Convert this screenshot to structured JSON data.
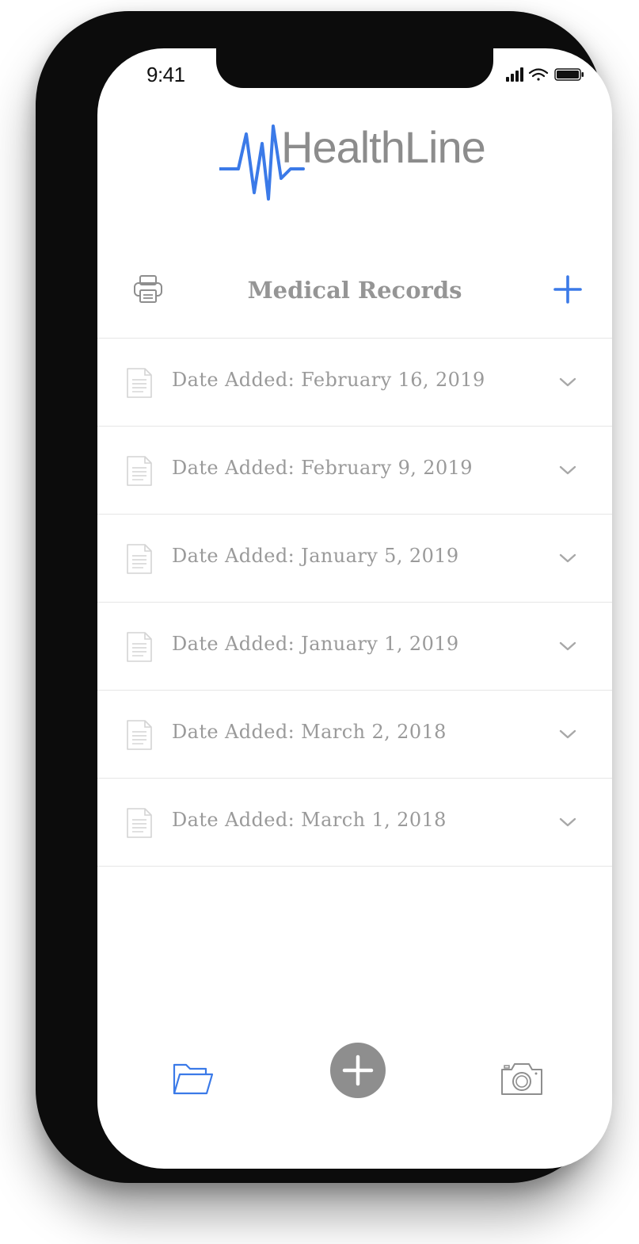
{
  "status_bar": {
    "time": "9:41"
  },
  "app": {
    "logo_text": "HealthLine",
    "accent_color": "#3b7ae8",
    "text_color": "#959595"
  },
  "header": {
    "title": "Medical Records",
    "left_icon": "printer-icon",
    "right_icon": "plus-icon"
  },
  "records": [
    {
      "label": "Date Added: February 16, 2019"
    },
    {
      "label": "Date Added: February 9, 2019"
    },
    {
      "label": "Date Added: January 5, 2019"
    },
    {
      "label": "Date Added: January 1, 2019"
    },
    {
      "label": "Date Added: March 2, 2018"
    },
    {
      "label": "Date Added: March 1, 2018"
    }
  ],
  "tab_bar": {
    "items": [
      {
        "icon": "folder-icon",
        "active": true
      },
      {
        "icon": "plus-circle-icon",
        "active": false
      },
      {
        "icon": "camera-icon",
        "active": false
      }
    ]
  }
}
